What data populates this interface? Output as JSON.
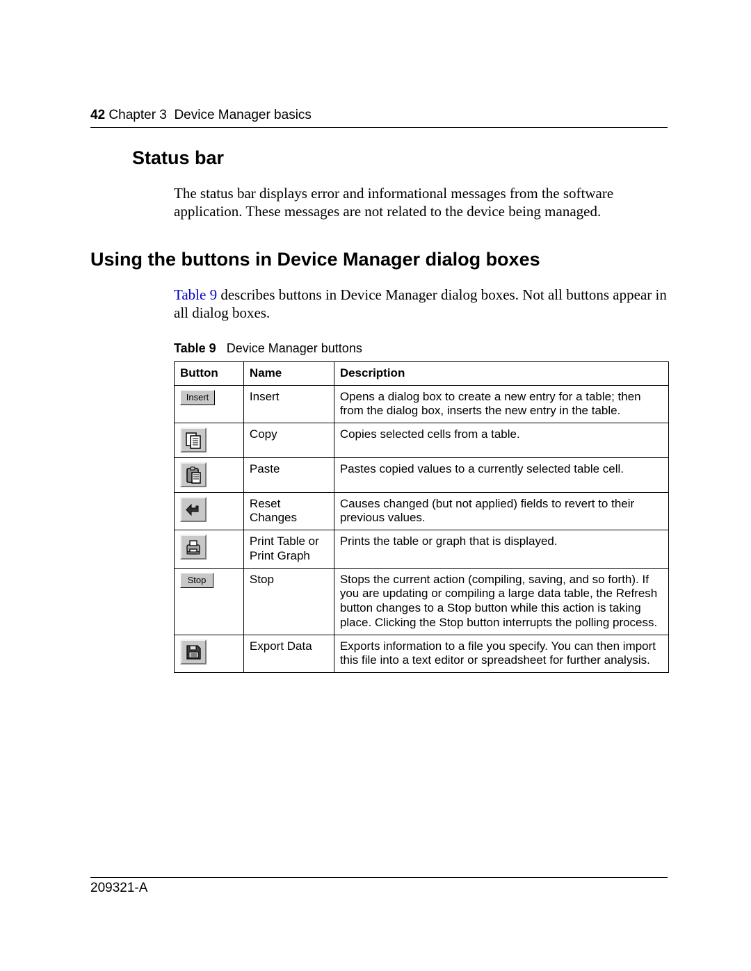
{
  "header": {
    "page_number": "42",
    "chapter_label": "Chapter 3",
    "chapter_title": "Device Manager basics"
  },
  "section1": {
    "heading": "Status bar",
    "paragraph": "The status bar displays error and informational messages from the software application. These messages are not related to the device being managed."
  },
  "section2": {
    "heading": "Using the buttons in Device Manager dialog boxes",
    "intro_ref": "Table 9",
    "intro_rest": " describes buttons in Device Manager dialog boxes. Not all buttons appear in all dialog boxes."
  },
  "table": {
    "caption_label": "Table 9",
    "caption_title": "Device Manager buttons",
    "headers": {
      "button": "Button",
      "name": "Name",
      "description": "Description"
    },
    "rows": [
      {
        "icon": "insert",
        "btn_label": "Insert",
        "name": "Insert",
        "description": "Opens a dialog box to create a new entry for a table; then from the dialog box, inserts the new entry in the table."
      },
      {
        "icon": "copy",
        "btn_label": "",
        "name": "Copy",
        "description": "Copies selected cells from a table."
      },
      {
        "icon": "paste",
        "btn_label": "",
        "name": "Paste",
        "description": "Pastes copied values to a currently selected table cell."
      },
      {
        "icon": "reset",
        "btn_label": "",
        "name": "Reset Changes",
        "description": "Causes changed (but not applied) fields to revert to their previous values."
      },
      {
        "icon": "print",
        "btn_label": "",
        "name": "Print Table or Print Graph",
        "description": "Prints the table or graph that is displayed."
      },
      {
        "icon": "stop",
        "btn_label": "Stop",
        "name": "Stop",
        "description": "Stops the current action (compiling, saving, and so forth). If you are updating or compiling a large data table, the Refresh button changes to a Stop button while this action is taking place. Clicking the Stop button interrupts the polling process."
      },
      {
        "icon": "export",
        "btn_label": "",
        "name": "Export Data",
        "description": "Exports information to a file you specify. You can then import this file into a text editor or spreadsheet for further analysis."
      }
    ]
  },
  "footer": {
    "doc_number": "209321-A"
  }
}
